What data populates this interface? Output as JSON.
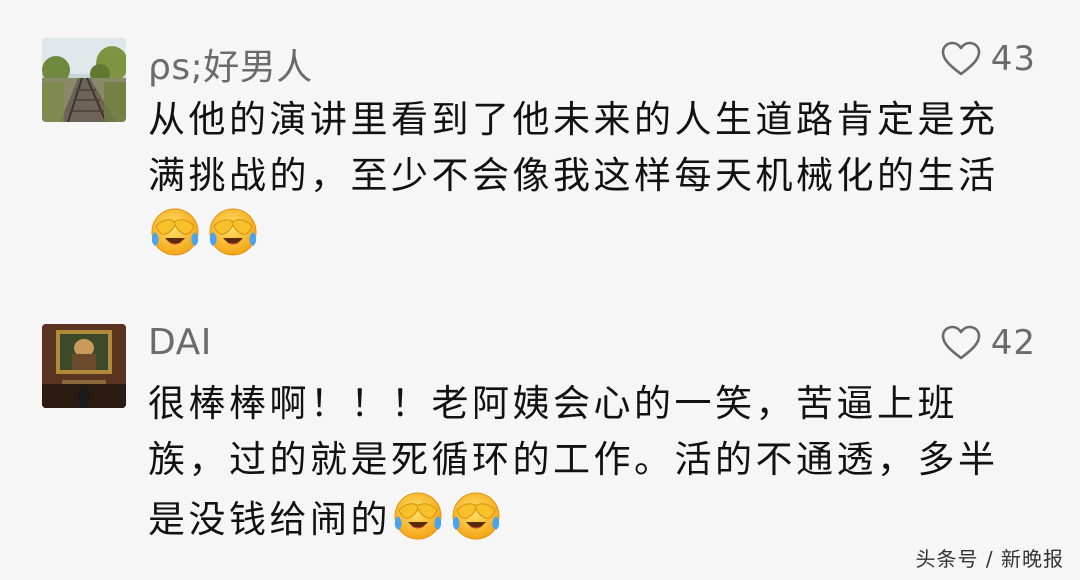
{
  "comments": [
    {
      "username": "ρs;好男人",
      "likes": "43",
      "avatar_icon": "railway-landscape-avatar",
      "lines": [
        "从他的演讲里看到了他未来的人生道路肯定是充",
        "满挑战的，至少不会像我这样每天机械化的生活"
      ],
      "emojis": [
        "crying-laughing-emoji",
        "crying-laughing-emoji"
      ]
    },
    {
      "username": "DAI",
      "likes": "42",
      "avatar_icon": "gallery-painting-avatar",
      "lines": [
        "很棒棒啊！！！老阿姨会心的一笑，苦逼上班",
        "族，过的就是死循环的工作。活的不通透，多半",
        "是没钱给闹的"
      ],
      "emojis": [
        "crying-laughing-emoji",
        "crying-laughing-emoji"
      ]
    }
  ],
  "watermark": "头条号 / 新晚报",
  "colors": {
    "background": "#f6f6f6",
    "secondary_text": "#6b6b6b",
    "primary_text": "#111111"
  }
}
